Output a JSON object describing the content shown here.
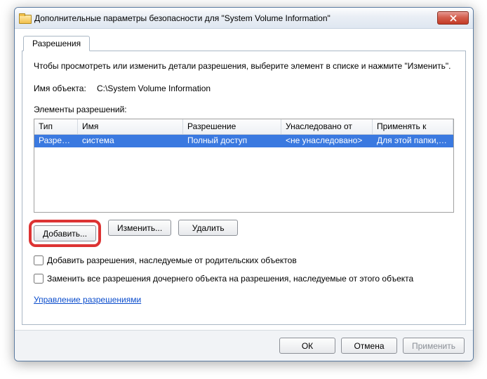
{
  "title": "Дополнительные параметры безопасности для \"System Volume Information\"",
  "tab": "Разрешения",
  "instruction": "Чтобы просмотреть или изменить детали разрешения, выберите элемент в списке и нажмите \"Изменить\".",
  "object_label": "Имя объекта:",
  "object_value": "C:\\System Volume Information",
  "perms_label": "Элементы разрешений:",
  "columns": {
    "c0": "Тип",
    "c1": "Имя",
    "c2": "Разрешение",
    "c3": "Унаследовано от",
    "c4": "Применять к"
  },
  "row": {
    "type": "Разреш...",
    "name": "система",
    "perm": "Полный доступ",
    "inherit": "<не унаследовано>",
    "apply": "Для этой папки, ее под..."
  },
  "buttons": {
    "add": "Добавить...",
    "edit": "Изменить...",
    "del": "Удалить"
  },
  "chk1": "Добавить разрешения, наследуемые от родительских объектов",
  "chk2": "Заменить все разрешения дочернего объекта на разрешения, наследуемые от этого объекта",
  "link": "Управление разрешениями",
  "footer": {
    "ok": "ОК",
    "cancel": "Отмена",
    "apply": "Применить"
  }
}
